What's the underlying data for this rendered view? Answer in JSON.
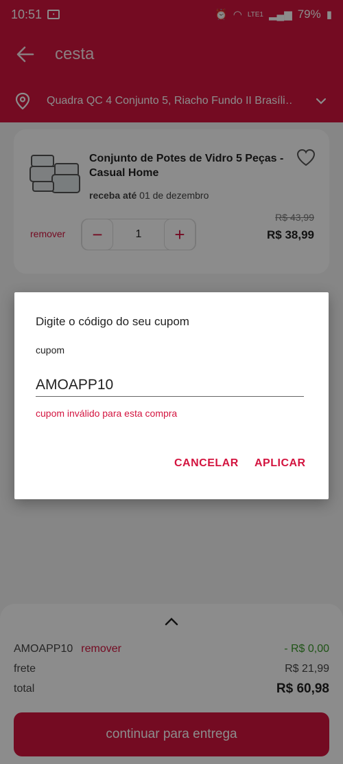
{
  "status_bar": {
    "time": "10:51",
    "battery": "79%",
    "network": "LTE1"
  },
  "header": {
    "title": "cesta"
  },
  "address": {
    "text": "Quadra QC 4 Conjunto 5, Riacho Fundo II Brasíli…"
  },
  "cart_item": {
    "name": "Conjunto de Potes de Vidro 5 Peças - Casual Home",
    "delivery_label": "receba até",
    "delivery_date": "01 de dezembro",
    "remove_label": "remover",
    "quantity": "1",
    "old_price": "R$ 43,99",
    "price": "R$ 38,99"
  },
  "dialog": {
    "title": "Digite o código do seu cupom",
    "field_label": "cupom",
    "field_value": "AMOAPP10",
    "error": "cupom inválido para esta compra",
    "cancel_label": "CANCELAR",
    "apply_label": "APLICAR"
  },
  "summary": {
    "coupon_code": "AMOAPP10",
    "coupon_remove_label": "remover",
    "coupon_discount": "- R$ 0,00",
    "shipping_label": "frete",
    "shipping_value": "R$ 21,99",
    "total_label": "total",
    "total_value": "R$ 60,98",
    "continue_label": "continuar para entrega"
  },
  "colors": {
    "brand": "#d3143f",
    "discount": "#3a9a2a"
  }
}
